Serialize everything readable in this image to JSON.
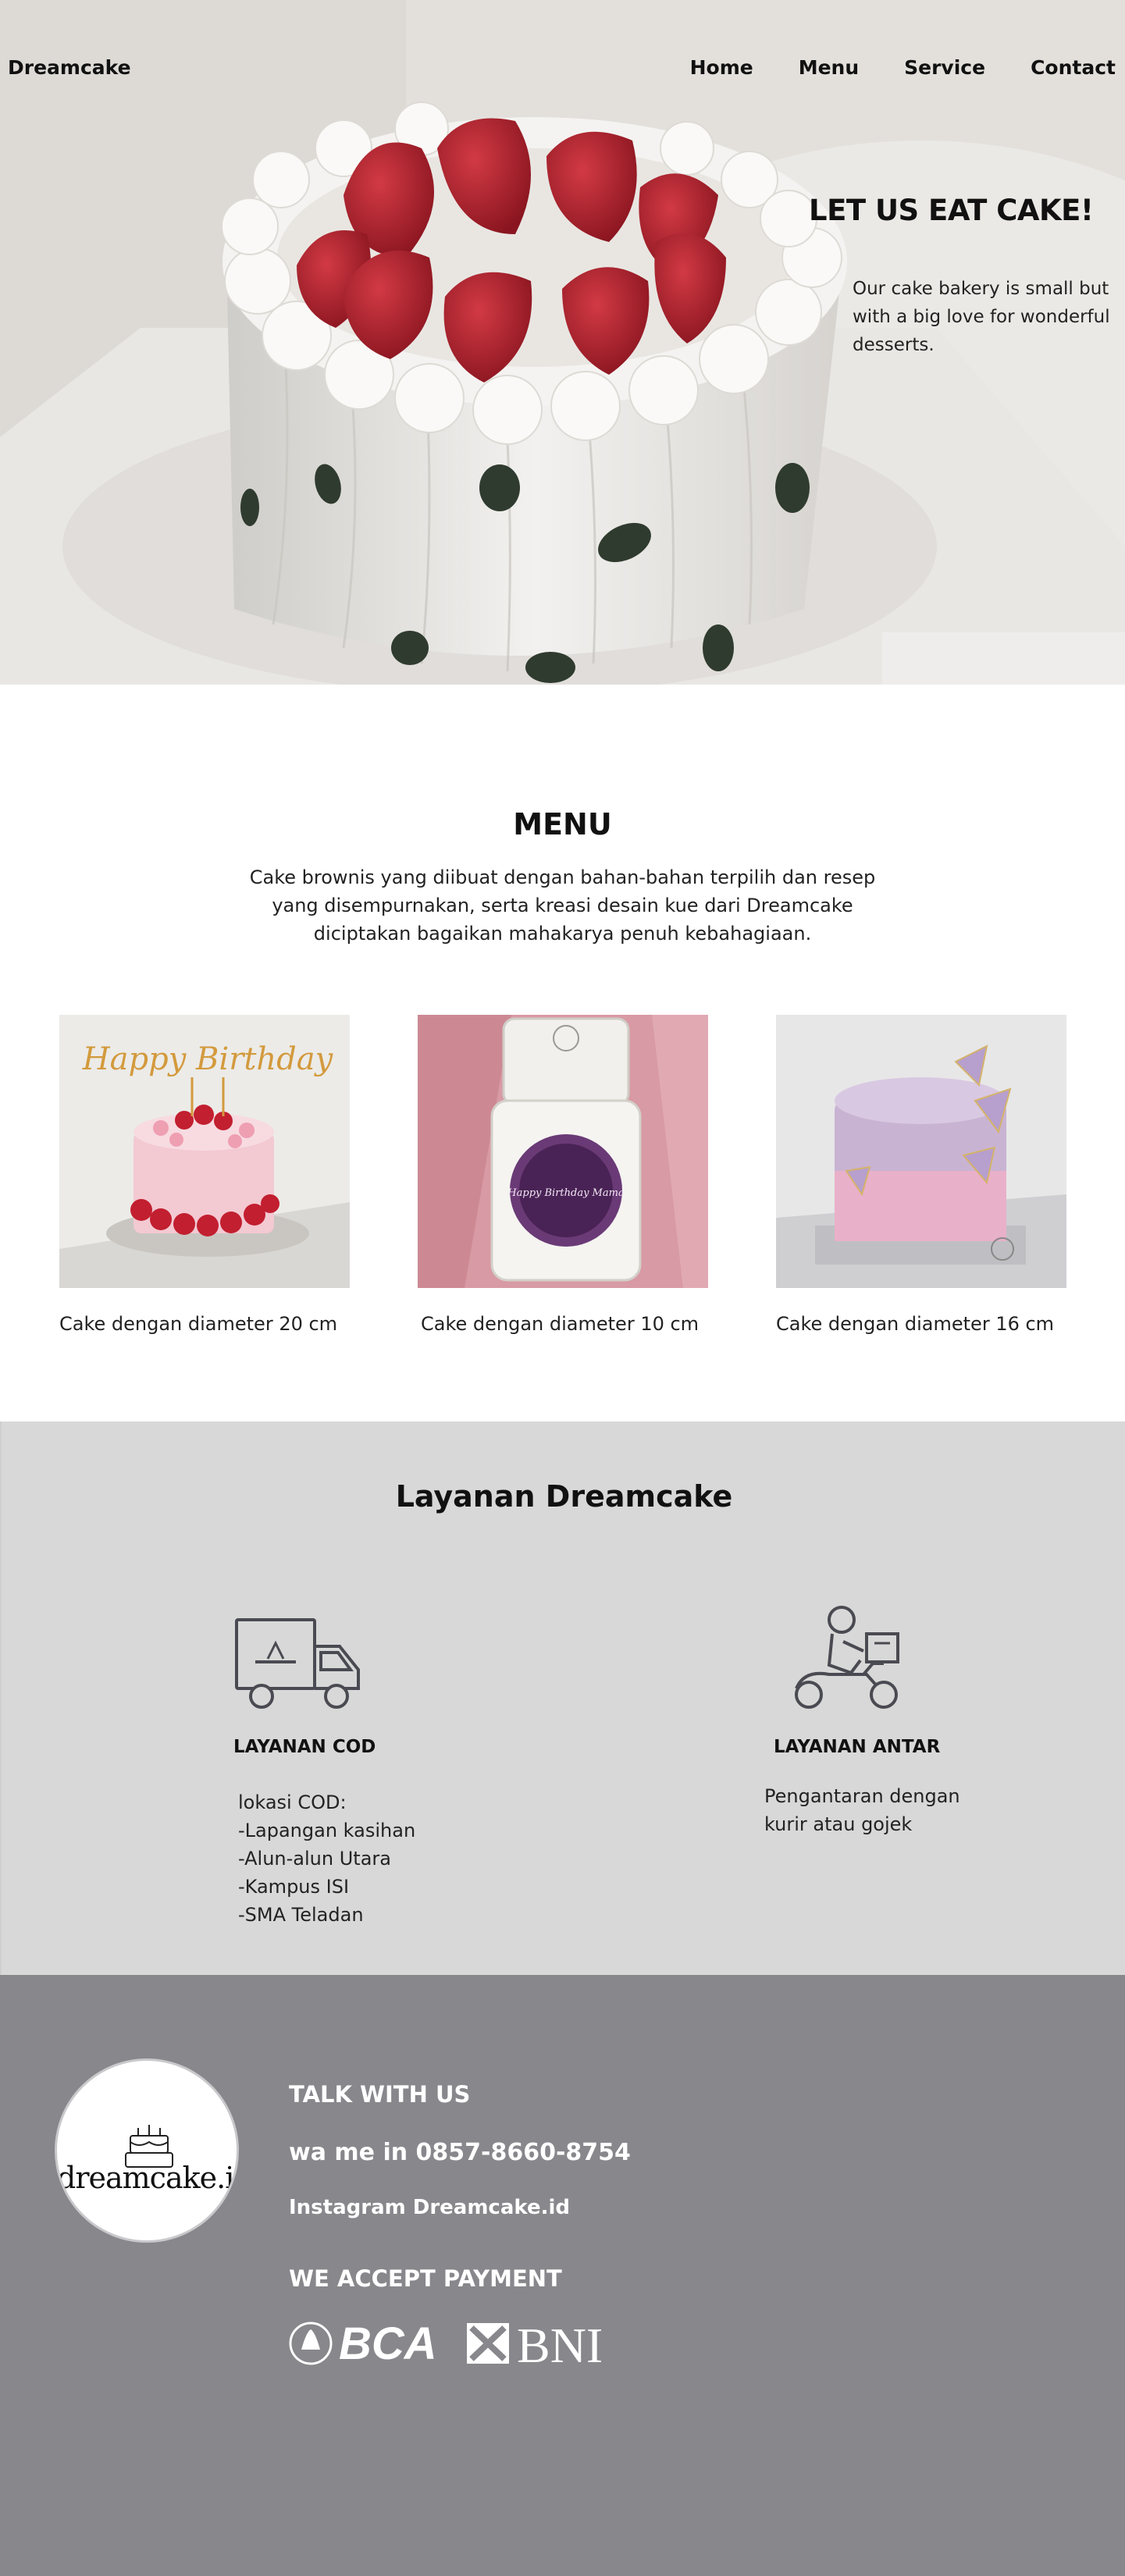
{
  "header": {
    "brand": "Dreamcake",
    "nav": [
      "Home",
      "Menu",
      "Service",
      "Contact"
    ]
  },
  "hero": {
    "title": "LET US EAT CAKE!",
    "text": "Our cake bakery is small but with a big love for wonderful desserts."
  },
  "menu": {
    "title": "MENU",
    "description": "Cake brownis yang diibuat dengan bahan-bahan terpilih dan resep yang disempurnakan, serta kreasi desain kue dari Dreamcake diciptakan bagaikan mahakarya penuh kebahagiaan.",
    "items": [
      {
        "caption": "Cake dengan diameter 20 cm",
        "topper": "Happy Birthday"
      },
      {
        "caption": "Cake dengan diameter 10 cm",
        "topper": "Happy Birthday Mama"
      },
      {
        "caption": "Cake dengan diameter 16 cm"
      }
    ]
  },
  "services": {
    "title": "Layanan Dreamcake",
    "cod": {
      "heading": "LAYANAN COD",
      "body": "lokasi COD:\n-Lapangan kasihan\n-Alun-alun Utara\n-Kampus ISI\n-SMA Teladan",
      "icon": "delivery-truck-icon"
    },
    "antar": {
      "heading": "LAYANAN ANTAR",
      "body": "Pengantaran dengan\nkurir atau gojek",
      "icon": "scooter-courier-icon"
    }
  },
  "footer": {
    "logo_text": "dreamcake.id",
    "talk": "TALK WITH US",
    "wa": "wa me in 0857-8660-8754",
    "instagram": "Instagram Dreamcake.id",
    "payment_title": "WE ACCEPT PAYMENT",
    "payments": [
      "BCA",
      "BNI"
    ]
  },
  "colors": {
    "services_bg": "#d8d8d8",
    "footer_bg": "#87878c",
    "footer_text": "#ffffff"
  }
}
